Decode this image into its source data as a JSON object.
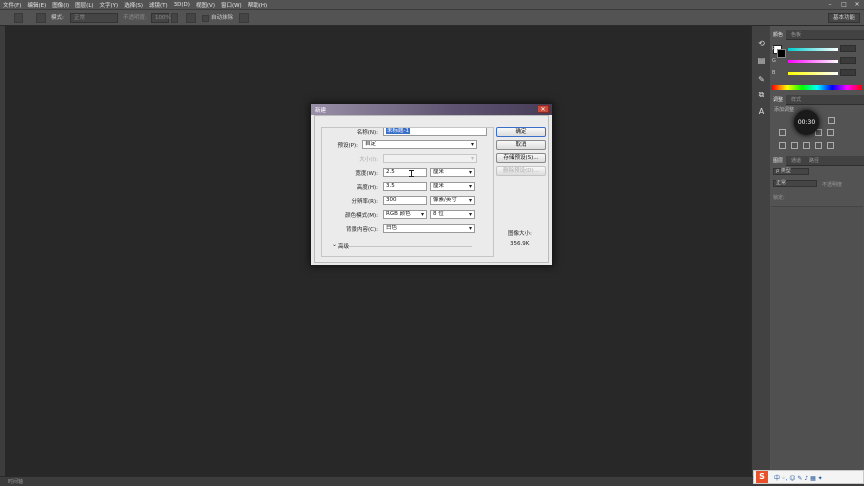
{
  "menubar": {
    "items": [
      "文件(F)",
      "编辑(E)",
      "图像(I)",
      "图层(L)",
      "文字(Y)",
      "选择(S)",
      "滤镜(T)",
      "3D(D)",
      "视图(V)",
      "窗口(W)",
      "帮助(H)"
    ]
  },
  "window_controls": {
    "minimize": "–",
    "maximize": "□",
    "close": "✕"
  },
  "options_bar": {
    "mode_label": "模式:",
    "mode_value": "正常",
    "opacity_label": "不透明度:",
    "opacity_value": "100%",
    "auto_erase_label": "自动抹除",
    "workspace_label": "基本功能"
  },
  "panels": {
    "color_tabs": [
      "颜色",
      "色板"
    ],
    "color_sliders": [
      "R",
      "G",
      "B"
    ],
    "adjust_tabs": [
      "调整",
      "样式"
    ],
    "adjust_hint": "添加调整",
    "layers_tabs": [
      "图层",
      "通道",
      "路径"
    ],
    "layers_kind": "ρ 类型",
    "layers_mode": "正常",
    "layers_opacity": "不透明度",
    "layers_lock": "锁定:"
  },
  "timer": "00:30",
  "status": {
    "text": "时间轴"
  },
  "ime": {
    "logo": "S",
    "glyphs": "中 ◦, ☺ ✎ ♪ ▦ ✦"
  },
  "dialog": {
    "title": "新建",
    "close_glyph": "✕",
    "name_label": "名称(N):",
    "name_value": "未标题-1",
    "preset_label": "预设(P):",
    "preset_value": "自定",
    "size_label": "大小(I):",
    "size_value": "",
    "width_label": "宽度(W):",
    "width_value": "2.5",
    "width_unit": "厘米",
    "height_label": "高度(H):",
    "height_value": "3.5",
    "height_unit": "厘米",
    "resolution_label": "分辨率(R):",
    "resolution_value": "300",
    "resolution_unit": "像素/英寸",
    "color_mode_label": "颜色模式(M):",
    "color_mode_value": "RGB 颜色",
    "bit_depth_value": "8 位",
    "background_label": "背景内容(C):",
    "background_value": "白色",
    "advanced_label": "高级",
    "advanced_toggle": "⌄",
    "ok_label": "确定",
    "cancel_label": "取消",
    "save_preset_label": "存储预设(S)...",
    "delete_preset_label": "删除预设(D)...",
    "image_size_label": "图像大小:",
    "image_size_value": "356.9K"
  },
  "colors": {
    "app_bg": "#282828",
    "chrome": "#535353",
    "dialog_title": "#5e5370",
    "accent": "#3a6fc9"
  }
}
